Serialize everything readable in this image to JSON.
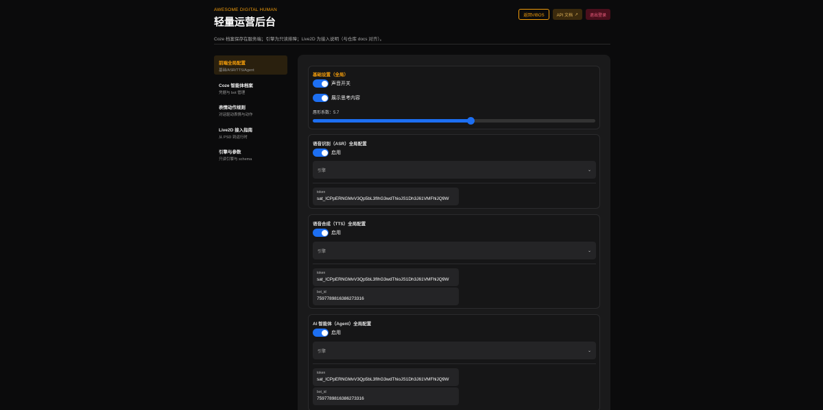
{
  "header": {
    "eyebrow": "AWESOME DIGITAL HUMAN",
    "title": "轻量运营后台",
    "subtitle": "Coze 档案保存在服务端；引擎为只读排障；Live2D 为接入说明（与仓库 docs 对齐）。",
    "back_label": "返回VIBOS",
    "api_label": "API 文档",
    "logout_label": "退出登录"
  },
  "sidebar": {
    "items": [
      {
        "title": "前端全局配置",
        "sub": "基础/ASR/TTS/Agent"
      },
      {
        "title": "Coze 智能体档案",
        "sub": "凭据与 bot 管理"
      },
      {
        "title": "表情动作规则",
        "sub": "对话驱动表情与动作"
      },
      {
        "title": "Live2D 接入指南",
        "sub": "从 PSD 到运行时"
      },
      {
        "title": "引擎与参数",
        "sub": "只读引擎与 schema"
      }
    ]
  },
  "basic": {
    "title": "基础设置（全局）",
    "sound_label": "声音开关",
    "sound_on": true,
    "thinking_label": "展示思考内容",
    "thinking_on": true,
    "slider_label": "唇形系数：5.7",
    "slider_fraction": 0.56
  },
  "asr": {
    "title": "语音识别（ASR）全局配置",
    "enable_label": "启用",
    "engine_placeholder": "引擎",
    "token_label": "token",
    "token_value": "sat_ICPpERNGMvV3Qp5bL3fIhG3wdThioJS1Dh3J61VMFhlJQ9W"
  },
  "tts": {
    "title": "语音合成（TTS）全局配置",
    "enable_label": "启用",
    "engine_placeholder": "引擎",
    "token_label": "token",
    "token_value": "sat_ICPpERNGMvV3Qp5bL3fIhG3wdThioJS1Dh3J61VMFhlJQ9W",
    "botid_label": "bot_id",
    "botid_value": "7597789816386273316"
  },
  "agent": {
    "title": "AI 智能体（Agent）全局配置",
    "enable_label": "启用",
    "engine_placeholder": "引擎",
    "token_label": "token",
    "token_value": "sat_ICPpERNGMvV3Qp5bL3fIhG3wdThioJS1Dh3J61VMFhlJQ9W",
    "botid_label": "bot_id",
    "botid_value": "7597789816386273316"
  },
  "colors": {
    "accent": "#f59e0b",
    "toggle": "#1d6ff2",
    "background": "#0b0b0c"
  }
}
